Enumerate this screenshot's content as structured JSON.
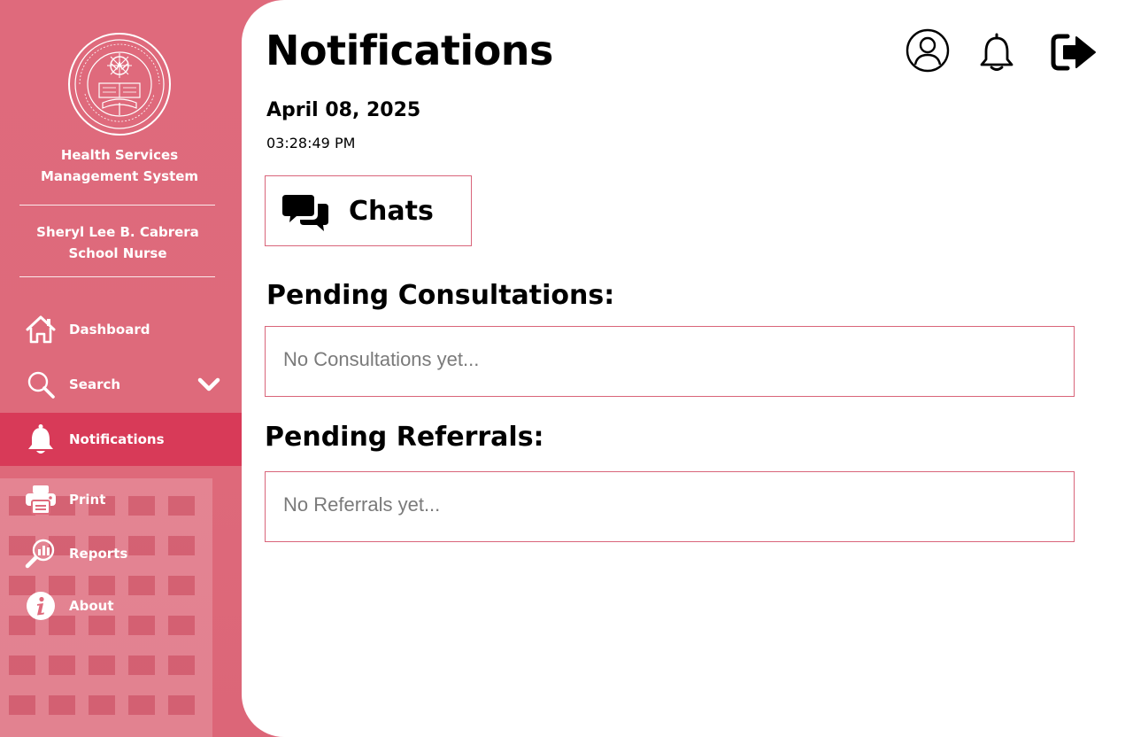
{
  "sidebar": {
    "system_name_line1": "Health Services",
    "system_name_line2": "Management System",
    "user_name": "Sheryl Lee B. Cabrera",
    "user_role": "School Nurse",
    "items": [
      {
        "label": "Dashboard",
        "icon": "home-icon"
      },
      {
        "label": "Search",
        "icon": "search-icon"
      },
      {
        "label": "Notifications",
        "icon": "bell-icon",
        "active": true
      },
      {
        "label": "Print",
        "icon": "printer-icon"
      },
      {
        "label": "Reports",
        "icon": "reports-icon"
      },
      {
        "label": "About",
        "icon": "info-icon"
      }
    ]
  },
  "header": {
    "title": "Notifications",
    "icons": [
      "profile-icon",
      "bell-icon",
      "logout-icon"
    ]
  },
  "datetime": {
    "date": "April 08, 2025",
    "time": "03:28:49 PM"
  },
  "chats": {
    "label": "Chats",
    "icon": "chat-bubbles-icon"
  },
  "consultations": {
    "heading": "Pending Consultations:",
    "empty_text": "No Consultations yet..."
  },
  "referrals": {
    "heading": "Pending Referrals:",
    "empty_text": "No Referrals yet..."
  },
  "colors": {
    "sidebar_bg": "#df6a7c",
    "active_item": "#d83a58",
    "box_border": "#d9657a",
    "placeholder_text": "#7a7a7a"
  }
}
